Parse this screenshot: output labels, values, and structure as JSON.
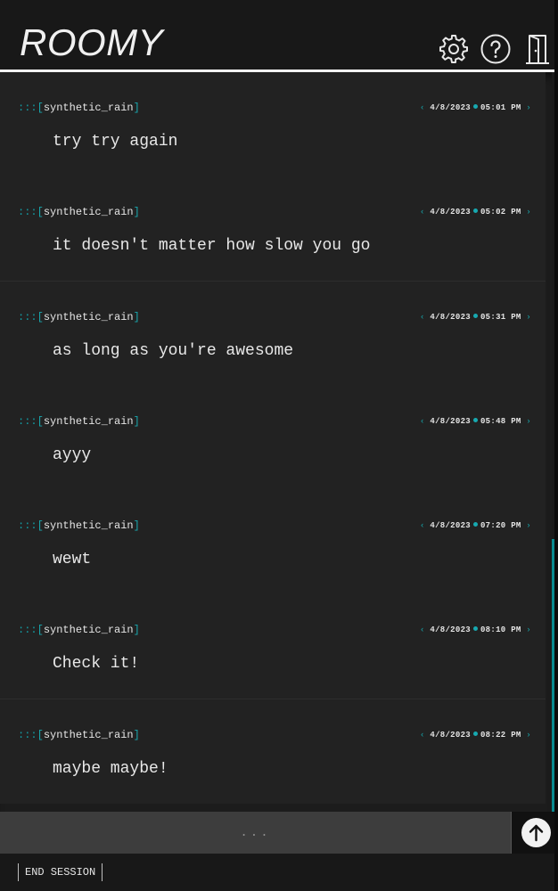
{
  "app": {
    "title": "ROOMY"
  },
  "header": {
    "icons": [
      "gear-icon",
      "help-icon",
      "exit-door-icon"
    ]
  },
  "messages": [
    {
      "prefix": ":::",
      "open": "[",
      "user": "synthetic_rain",
      "close": "]",
      "date": "4/8/2023",
      "time": "05:01 PM",
      "text": "try try again"
    },
    {
      "prefix": ":::",
      "open": "[",
      "user": "synthetic_rain",
      "close": "]",
      "date": "4/8/2023",
      "time": "05:02 PM",
      "text": "it doesn't matter how slow you go"
    },
    {
      "prefix": ":::",
      "open": "[",
      "user": "synthetic_rain",
      "close": "]",
      "date": "4/8/2023",
      "time": "05:31 PM",
      "text": "as long as you're awesome"
    },
    {
      "prefix": ":::",
      "open": "[",
      "user": "synthetic_rain",
      "close": "]",
      "date": "4/8/2023",
      "time": "05:48 PM",
      "text": "ayyy"
    },
    {
      "prefix": ":::",
      "open": "[",
      "user": "synthetic_rain",
      "close": "]",
      "date": "4/8/2023",
      "time": "07:20 PM",
      "text": "wewt"
    },
    {
      "prefix": ":::",
      "open": "[",
      "user": "synthetic_rain",
      "close": "]",
      "date": "4/8/2023",
      "time": "08:10 PM",
      "text": "Check it!"
    },
    {
      "prefix": ":::",
      "open": "[",
      "user": "synthetic_rain",
      "close": "]",
      "date": "4/8/2023",
      "time": "08:22 PM",
      "text": "maybe maybe!"
    }
  ],
  "stamp_chevrons": {
    "left": "‹",
    "right": "›"
  },
  "composer": {
    "placeholder": "...",
    "value": ""
  },
  "send": {
    "icon": "arrow-up-icon"
  },
  "footer": {
    "end_session_label": "END SESSION"
  },
  "colors": {
    "accent": "#17a9b0",
    "background": "#1c1c1c",
    "message_bg": "#222222",
    "composer_bg": "#3d3d3d"
  }
}
